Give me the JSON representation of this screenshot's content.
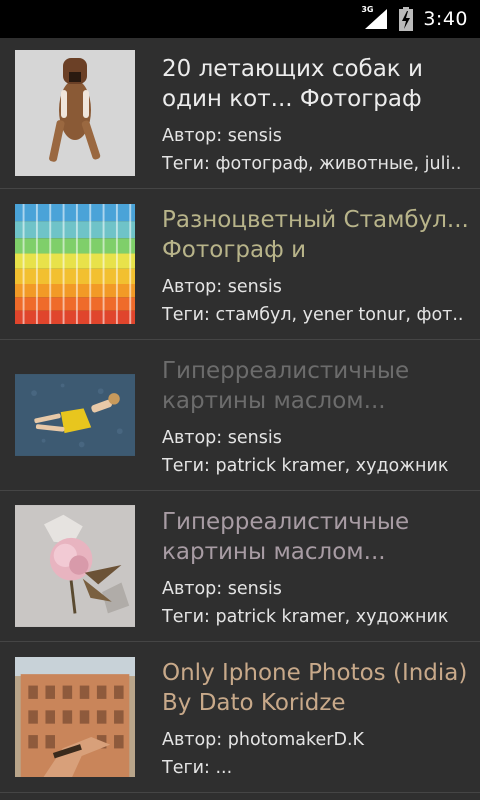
{
  "status_bar": {
    "network": "3G",
    "time": "3:40"
  },
  "items": [
    {
      "title": "20 летающих собак и один кот... Фотограф",
      "author": "Автор: sensis",
      "tags": "Теги: фотограф, животные, juli..",
      "title_color": "#ececec",
      "thumb_icon": "flying-dog-photo-icon"
    },
    {
      "title": "Разноцветный Стамбул... Фотограф и",
      "author": "Автор: sensis",
      "tags": "Теги: стамбул, yener tonur, фот..",
      "title_color": "#b8b48a",
      "thumb_icon": "colorful-building-photo-icon"
    },
    {
      "title": "Гиперреалистичные картины маслом...",
      "author": "Автор: sensis",
      "tags": "Теги: patrick kramer, художник",
      "title_color": "#6c6c6c",
      "thumb_icon": "girl-yellow-dress-painting-icon"
    },
    {
      "title": "Гиперреалистичные картины маслом...",
      "author": "Автор: sensis",
      "tags": "Теги: patrick kramer, художник",
      "title_color": "#a89ca4",
      "thumb_icon": "flower-painting-icon"
    },
    {
      "title": "Only Iphone Photos (India)  By Dato Koridze",
      "author": "Автор: photomakerD.K",
      "tags": "Теги: ...",
      "title_color": "#c8a98a",
      "thumb_icon": "india-palace-photo-icon"
    }
  ]
}
